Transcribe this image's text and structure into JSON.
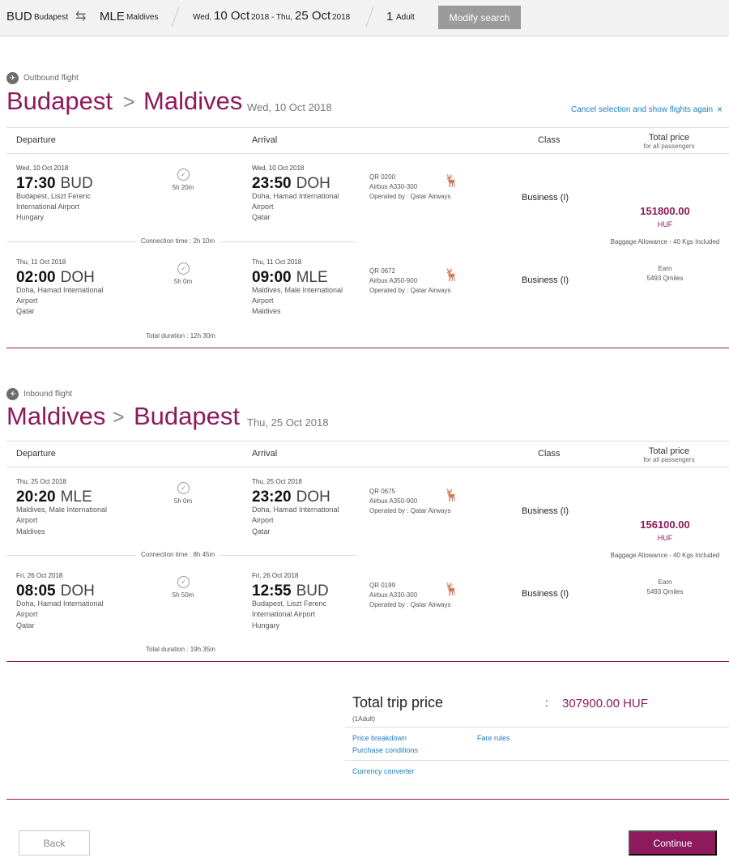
{
  "search_bar": {
    "origin_code": "BUD",
    "origin_city": "Budapest",
    "swap_icon": "round-trip-arrows-icon",
    "destination_code": "MLE",
    "destination_city": "Maldives",
    "depart_weekday": "Wed,",
    "depart_date": "10 Oct",
    "depart_year": "2018",
    "date_separator": "- Thu,",
    "return_date": "25 Oct",
    "return_year": "2018",
    "passenger_count": "1",
    "passenger_label": "Adult",
    "modify_label": "Modify search"
  },
  "outbound": {
    "direction_label": "Outbound flight",
    "from_city": "Budapest",
    "arrow": ">",
    "to_city": "Maldives",
    "date": "Wed, 10 Oct 2018",
    "cancel_link": "Cancel selection and show flights again",
    "close": "×",
    "headers": {
      "departure": "Departure",
      "arrival": "Arrival",
      "class": "Class",
      "total_price": "Total price",
      "total_price_sub": "for all passengers"
    },
    "legs": [
      {
        "dep_date": "Wed, 10 Oct 2018",
        "dep_time": "17:30",
        "dep_code": "BUD",
        "dep_place": "Budapest, Liszt Ferenc International Airport",
        "dep_country": "Hungary",
        "duration": "5h 20m",
        "arr_date": "Wed, 10 Oct 2018",
        "arr_time": "23:50",
        "arr_code": "DOH",
        "arr_place": "Doha, Hamad International Airport",
        "arr_country": "Qatar",
        "flight_no": "QR 0200",
        "aircraft": "Airbus A330-300",
        "operator": "Operated by : Qatar Airways",
        "class": "Business (I)"
      },
      {
        "dep_date": "Thu, 11 Oct 2018",
        "dep_time": "02:00",
        "dep_code": "DOH",
        "dep_place": "Doha, Hamad International Airport",
        "dep_country": "Qatar",
        "duration": "5h 0m",
        "arr_date": "Thu, 11 Oct 2018",
        "arr_time": "09:00",
        "arr_code": "MLE",
        "arr_place": "Maldives, Male International Airport",
        "arr_country": "Maldives",
        "flight_no": "QR 0672",
        "aircraft": "Airbus A350-900",
        "operator": "Operated by : Qatar Airways",
        "class": "Business (I)"
      }
    ],
    "connection": "Connection time : 2h 10m",
    "total_duration": "Total duration : 12h 30m",
    "price": "151800.00",
    "currency": "HUF",
    "baggage": "Baggage Allowance - 40 Kgs Included",
    "earn_label": "Earn",
    "qmiles": "5493 Qmiles"
  },
  "inbound": {
    "direction_label": "Inbound flight",
    "from_city": "Maldives",
    "arrow": ">",
    "to_city": "Budapest",
    "date": "Thu, 25 Oct 2018",
    "headers": {
      "departure": "Departure",
      "arrival": "Arrival",
      "class": "Class",
      "total_price": "Total price",
      "total_price_sub": "for all passengers"
    },
    "legs": [
      {
        "dep_date": "Thu, 25 Oct 2018",
        "dep_time": "20:20",
        "dep_code": "MLE",
        "dep_place": "Maldives, Male International Airport",
        "dep_country": "Maldives",
        "duration": "5h 0m",
        "arr_date": "Thu, 25 Oct 2018",
        "arr_time": "23:20",
        "arr_code": "DOH",
        "arr_place": "Doha, Hamad International Airport",
        "arr_country": "Qatar",
        "flight_no": "QR 0675",
        "aircraft": "Airbus A350-900",
        "operator": "Operated by : Qatar Airways",
        "class": "Business (I)"
      },
      {
        "dep_date": "Fri, 26 Oct 2018",
        "dep_time": "08:05",
        "dep_code": "DOH",
        "dep_place": "Doha, Hamad International Airport",
        "dep_country": "Qatar",
        "duration": "5h 50m",
        "arr_date": "Fri, 26 Oct 2018",
        "arr_time": "12:55",
        "arr_code": "BUD",
        "arr_place": "Budapest, Liszt Ferenc International Airport",
        "arr_country": "Hungary",
        "flight_no": "QR 0199",
        "aircraft": "Airbus A330-300",
        "operator": "Operated by : Qatar Airways",
        "class": "Business (I)"
      }
    ],
    "connection": "Connection time : 8h 45m",
    "total_duration": "Total duration : 19h 35m",
    "price": "156100.00",
    "currency": "HUF",
    "baggage": "Baggage Allowance - 40 Kgs Included",
    "earn_label": "Earn",
    "qmiles": "5493 Qmiles"
  },
  "summary": {
    "title": "Total trip price",
    "passengers": "(1Adult)",
    "colon": ":",
    "total": "307900.00 HUF",
    "price_breakdown": "Price breakdown",
    "fare_rules": "Fare rules",
    "purchase_conditions": "Purchase conditions",
    "currency_converter": "Currency converter"
  },
  "footer": {
    "back_label": "Back",
    "continue_label": "Continue"
  },
  "icons": {
    "clock": "clock-icon",
    "airline_logo": "qatar-oryx-logo-icon",
    "outbound_plane": "plane-right-icon",
    "inbound_plane": "plane-left-icon"
  },
  "colors": {
    "brand": "#8d1a5c",
    "link": "#1f7ec2",
    "topbar": "#f2f2f2",
    "modify_button": "#9b9b9b"
  }
}
